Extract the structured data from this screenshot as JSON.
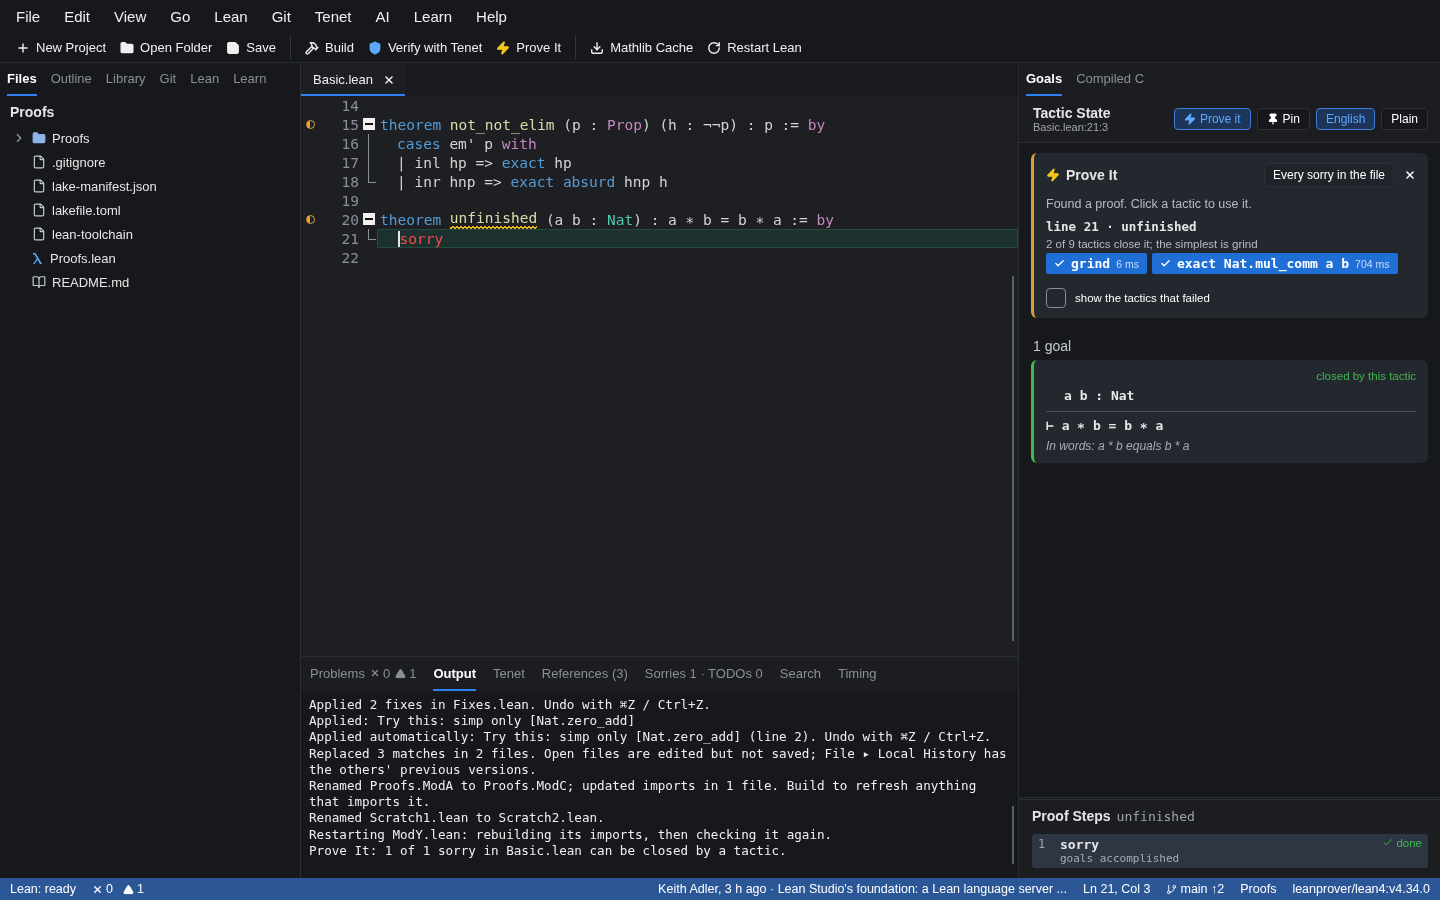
{
  "menu": [
    "File",
    "Edit",
    "View",
    "Go",
    "Lean",
    "Git",
    "Tenet",
    "AI",
    "Learn",
    "Help"
  ],
  "toolbar": [
    [
      {
        "label": "New Project"
      },
      {
        "label": "Open Folder"
      },
      {
        "label": "Save"
      }
    ],
    [
      {
        "label": "Build"
      },
      {
        "label": "Verify with Tenet"
      },
      {
        "label": "Prove It"
      }
    ],
    [
      {
        "label": "Mathlib Cache"
      },
      {
        "label": "Restart Lean"
      }
    ]
  ],
  "sidebar": {
    "tabs": [
      {
        "label": "Files",
        "selected": true
      },
      {
        "label": "Outline",
        "selected": false
      },
      {
        "label": "Library",
        "selected": false
      },
      {
        "label": "Git",
        "selected": false
      },
      {
        "label": "Lean",
        "selected": false
      },
      {
        "label": "Learn",
        "selected": false
      }
    ],
    "heading": "Proofs",
    "tree": [
      {
        "label": "Proofs",
        "kind": "folder",
        "expanded": false
      },
      {
        "label": ".gitignore",
        "kind": "file"
      },
      {
        "label": "lake-manifest.json",
        "kind": "file"
      },
      {
        "label": "lakefile.toml",
        "kind": "file"
      },
      {
        "label": "lean-toolchain",
        "kind": "file"
      },
      {
        "label": "Proofs.lean",
        "kind": "lean"
      },
      {
        "label": "README.md",
        "kind": "book"
      }
    ]
  },
  "editor": {
    "tabs": [
      {
        "label": "Basic.lean",
        "selected": true
      }
    ],
    "lines": [
      {
        "number": "14"
      },
      {
        "number": "15",
        "marker": true,
        "kind": "fold-start",
        "tokens": [
          {
            "t": "theorem ",
            "kind": "keyword"
          },
          {
            "t": "not_not_elim",
            "kind": "name"
          },
          {
            "t": " (p : ",
            "kind": "plain"
          },
          {
            "t": "Prop",
            "kind": "control"
          },
          {
            "t": ") (h : ¬¬p) : p := ",
            "kind": "plain"
          },
          {
            "t": "by",
            "kind": "control"
          }
        ]
      },
      {
        "number": "16",
        "kind": "fold-body",
        "indented": true,
        "tokens": [
          {
            "t": "cases",
            "kind": "keyword"
          },
          {
            "t": " em' p ",
            "kind": "plain"
          },
          {
            "t": "with",
            "kind": "control"
          }
        ]
      },
      {
        "number": "17",
        "kind": "fold-body",
        "indented": true,
        "tokens": [
          {
            "t": "| inl hp => ",
            "kind": "plain"
          },
          {
            "t": "exact",
            "kind": "keyword"
          },
          {
            "t": " hp",
            "kind": "plain"
          }
        ]
      },
      {
        "number": "18",
        "kind": "fold-end",
        "indented": true,
        "tokens": [
          {
            "t": "| inr hnp => ",
            "kind": "plain"
          },
          {
            "t": "exact ",
            "kind": "keyword"
          },
          {
            "t": "absurd",
            "kind": "keyword"
          },
          {
            "t": " hnp h",
            "kind": "plain"
          }
        ]
      },
      {
        "number": "19"
      },
      {
        "number": "20",
        "marker": true,
        "kind": "fold-start",
        "tokens": [
          {
            "t": "theorem ",
            "kind": "keyword"
          },
          {
            "t": "unfinished",
            "kind": "name",
            "warning": true
          },
          {
            "t": " (a b : ",
            "kind": "plain"
          },
          {
            "t": "Nat",
            "kind": "type"
          },
          {
            "t": ") : a ∗ b = b ∗ a := ",
            "kind": "plain"
          },
          {
            "t": "by",
            "kind": "control"
          }
        ]
      },
      {
        "number": "21",
        "kind": "fold-end",
        "indented": true,
        "current": true,
        "tokens": [
          {
            "t": "sorry",
            "kind": "error"
          }
        ]
      },
      {
        "number": "22"
      }
    ]
  },
  "panel": {
    "tabs": [
      {
        "label": "Problems",
        "kind": "problems",
        "errors": "0",
        "warnings": "1",
        "selected": false
      },
      {
        "label": "Output",
        "selected": true
      },
      {
        "label": "Tenet",
        "selected": false
      },
      {
        "label": "References (3)",
        "selected": false
      },
      {
        "label": "Sorries 1 · TODOs 0",
        "selected": false
      },
      {
        "label": "Search",
        "selected": false
      },
      {
        "label": "Timing",
        "selected": false
      }
    ],
    "output": [
      "Applied 2 fixes in Fixes.lean. Undo with ⌘Z / Ctrl+Z.",
      "Applied: Try this: simp only [Nat.zero_add]",
      "Applied automatically: Try this: simp only [Nat.zero_add] (line 2). Undo with ⌘Z / Ctrl+Z.",
      "Replaced 3 matches in 2 files. Open files are edited but not saved; File ▸ Local History has the others' previous versions.",
      "Renamed Proofs.ModA to Proofs.ModC; updated imports in 1 file. Build to refresh anything that imports it.",
      "Renamed Scratch1.lean to Scratch2.lean.",
      "Restarting ModY.lean: rebuilding its imports, then checking it again.",
      "Prove It: 1 of 1 sorry in Basic.lean can be closed by a tactic."
    ]
  },
  "right": {
    "tabs": [
      {
        "label": "Goals",
        "selected": true
      },
      {
        "label": "Compiled C",
        "selected": false
      }
    ],
    "tactic_state": {
      "title": "Tactic State",
      "location": "Basic.lean:21:3",
      "actions": [
        {
          "label": "Prove it",
          "active": true
        },
        {
          "label": "Pin",
          "active": false
        }
      ],
      "modes": [
        {
          "label": "English",
          "selected": true
        },
        {
          "label": "Plain",
          "selected": false
        }
      ]
    },
    "prove_it": {
      "title": "Prove It",
      "scope": "Every sorry in the file",
      "message": "Found a proof. Click a tactic to use it.",
      "target": "line 21 · unfinished",
      "summary": "2 of 9 tactics close it; the simplest is grind",
      "tactics": [
        {
          "label": "grind",
          "time": "6 ms"
        },
        {
          "label": "exact Nat.mul_comm a b",
          "time": "704 ms"
        }
      ],
      "failed_toggle": {
        "label": "show the tactics that failed",
        "checked": false
      }
    },
    "goals": {
      "count": "1 goal",
      "items": [
        {
          "status": "closed by this tactic",
          "hypothesis": "a b : Nat",
          "target": "⊢ a ∗ b = b ∗ a",
          "words": "In words: a * b equals b * a"
        }
      ]
    },
    "proof_steps": {
      "title": "Proof Steps",
      "state": "unfinished",
      "steps": [
        {
          "number": "1",
          "tactic": "sorry",
          "note": "goals accomplished",
          "status": "done"
        }
      ]
    }
  },
  "status_bar": {
    "state": "Lean: ready",
    "errors": "0",
    "warnings": "1",
    "blame": "Keith Adler, 3 h ago · Lean Studio's foundation: a Lean language server ...",
    "position": "Ln 21, Col 3",
    "branch": "main ↑2",
    "project": "Proofs",
    "toolchain": "leanprover/lean4:v4.34.0"
  }
}
